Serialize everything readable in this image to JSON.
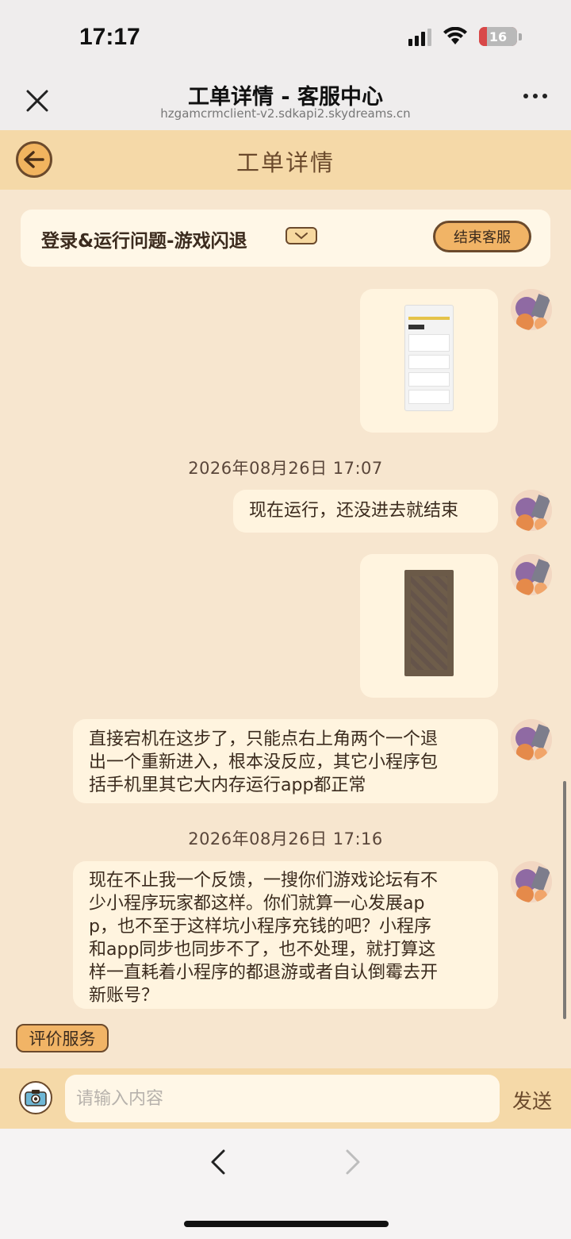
{
  "status_bar": {
    "time": "17:17",
    "battery": "16"
  },
  "browser_header": {
    "title": "工单详情 - 客服中心",
    "url": "hzgamcrmclient-v2.sdkapi2.skydreams.cn"
  },
  "page": {
    "title": "工单详情"
  },
  "ticket": {
    "category": "登录&运行问题-游戏闪退",
    "end_service_label": "结束客服"
  },
  "messages": {
    "timestamp_1": "2026年08月26日 17:07",
    "msg_1": "现在运行，还没进去就结束",
    "msg_2_line1": "直接宕机在这步了，只能点右上角两个一个退",
    "msg_2_line2": "出一个重新进入，根本没反应，其它小程序包",
    "msg_2_line3": "括手机里其它大内存运行app都正常",
    "timestamp_2": "2026年08月26日 17:16",
    "msg_3_line1": "现在不止我一个反馈，一搜你们游戏论坛有不",
    "msg_3_line2": "少小程序玩家都这样。你们就算一心发展ap",
    "msg_3_line3": "p，也不至于这样坑小程序充钱的吧？小程序",
    "msg_3_line4": "和app同步也同步不了，也不处理，就打算这",
    "msg_3_line5": "样一直耗着小程序的都退游或者自认倒霉去开",
    "msg_3_line6": "新账号？"
  },
  "rate_service_label": "评价服务",
  "input": {
    "placeholder": "请输入内容",
    "send_label": "发送"
  },
  "colors": {
    "page_bg": "#f7e6cf",
    "header_bg": "#f5d9a8",
    "bubble_bg": "#fff4df",
    "accent": "#f1b466",
    "text_brown": "#6b4a2c"
  },
  "icons": {
    "close": "close-icon",
    "more": "more-icon",
    "back": "back-arrow-icon",
    "camera": "camera-icon",
    "nav_back": "chevron-left-icon",
    "nav_forward": "chevron-right-icon"
  }
}
